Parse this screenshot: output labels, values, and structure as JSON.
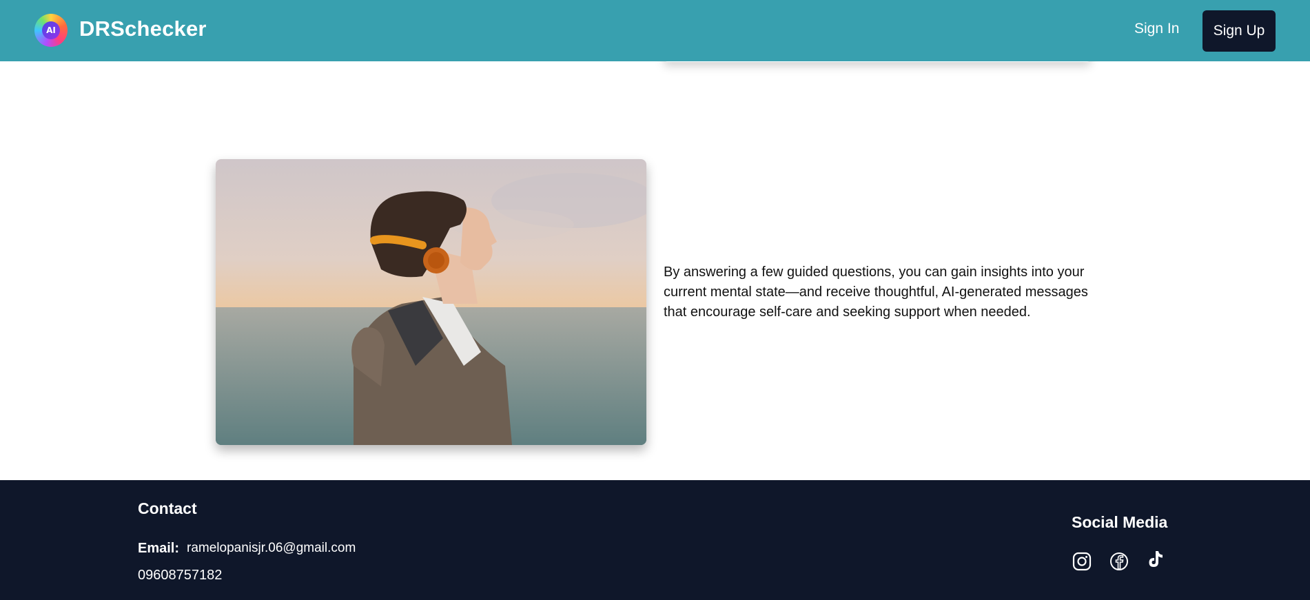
{
  "header": {
    "logo_text": "AI",
    "brand": "DRSchecker",
    "sign_in_label": "Sign In",
    "sign_up_label": "Sign Up",
    "background_color": "#38a0af"
  },
  "main": {
    "image_description_icon": "person-with-headphones-photo",
    "description": "By answering a few guided questions, you can gain insights into your current mental state—and receive thoughtful, AI-generated messages that encourage self-care and seeking support when needed."
  },
  "footer": {
    "contact_title": "Contact",
    "email_label": "Email:",
    "email_value": "ramelopanisjr.06@gmail.com",
    "phone": "09608757182",
    "social_title": "Social Media",
    "social_icons": [
      "instagram-icon",
      "facebook-icon",
      "tiktok-icon"
    ],
    "background_color": "#0f172a"
  }
}
